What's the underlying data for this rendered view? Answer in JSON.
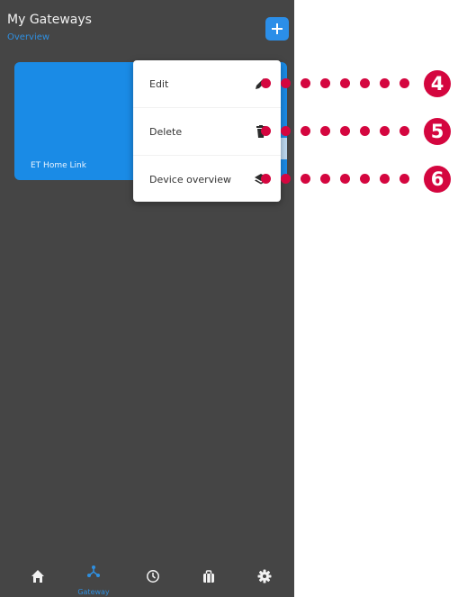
{
  "header": {
    "title": "My Gateways",
    "subtitle": "Overview",
    "add_icon": "plus-icon"
  },
  "gateway_card": {
    "name": "ET Home Link"
  },
  "context_menu": {
    "items": [
      {
        "label": "Edit",
        "icon": "pencil-icon"
      },
      {
        "label": "Delete",
        "icon": "trash-icon"
      },
      {
        "label": "Device overview",
        "icon": "layers-icon"
      }
    ]
  },
  "callouts": [
    {
      "number": "4"
    },
    {
      "number": "5"
    },
    {
      "number": "6"
    }
  ],
  "tabbar": {
    "tabs": [
      {
        "icon": "home-icon",
        "label": ""
      },
      {
        "icon": "gateway-icon",
        "label": "Gateway"
      },
      {
        "icon": "clock-icon",
        "label": ""
      },
      {
        "icon": "briefcase-icon",
        "label": ""
      },
      {
        "icon": "gear-icon",
        "label": ""
      }
    ]
  },
  "colors": {
    "background": "#454545",
    "accent": "#1a8be6",
    "callout": "#d4063f"
  }
}
